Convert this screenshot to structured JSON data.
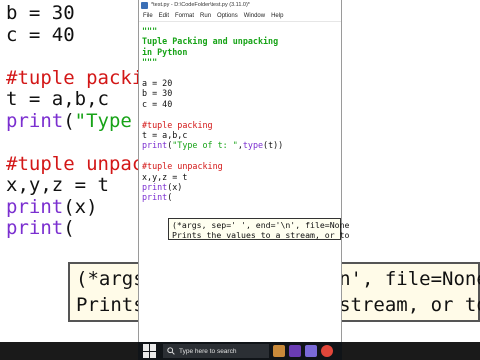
{
  "window": {
    "title": "*test.py - D:\\CodeFolder\\test.py (3.11.0)*",
    "menu": [
      "File",
      "Edit",
      "Format",
      "Run",
      "Options",
      "Window",
      "Help"
    ]
  },
  "editor": {
    "lines": [
      {
        "text": "\"\"\"",
        "kind": "str"
      },
      {
        "text": "Tuple Packing and unpacking",
        "kind": "str"
      },
      {
        "text": "in Python",
        "kind": "str"
      },
      {
        "text": "\"\"\"",
        "kind": "str"
      },
      {
        "text": "",
        "kind": "code"
      },
      {
        "text": "a = 20",
        "kind": "code"
      },
      {
        "text": "b = 30",
        "kind": "code"
      },
      {
        "text": "c = 40",
        "kind": "code"
      },
      {
        "text": "",
        "kind": "code"
      },
      {
        "text": "#tuple packing",
        "kind": "comment"
      },
      {
        "text": "t = a,b,c",
        "kind": "code"
      },
      {
        "text": "print(\"Type of t: \",type(t))",
        "kind": "mixed_print_type"
      },
      {
        "text": "",
        "kind": "code"
      },
      {
        "text": "#tuple unpacking",
        "kind": "comment"
      },
      {
        "text": "x,y,z = t",
        "kind": "code"
      },
      {
        "text": "print(x)",
        "kind": "print"
      },
      {
        "text": "print(",
        "kind": "print"
      }
    ],
    "tooltip": [
      "(*args, sep=' ', end='\\n', file=None",
      "Prints the values to a stream, or to"
    ]
  },
  "background": {
    "lines": [
      {
        "text": "b = 30",
        "kind": "code"
      },
      {
        "text": "c = 40",
        "kind": "code"
      },
      {
        "text": "",
        "kind": "code"
      },
      {
        "text": "#tuple packing",
        "kind": "comment"
      },
      {
        "text": "t = a,b,c",
        "kind": "code"
      },
      {
        "text": "print(\"Type of t: \",type(t))",
        "kind": "print_partial"
      },
      {
        "text": "",
        "kind": "code"
      },
      {
        "text": "#tuple unpacking",
        "kind": "comment"
      },
      {
        "text": "x,y,z = t",
        "kind": "code"
      },
      {
        "text": "print(x)",
        "kind": "print"
      },
      {
        "text": "print(",
        "kind": "print"
      }
    ],
    "tooltip": [
      "(*args, sep=' ', end='\\n', file=None",
      "Prints the values to a stream, or to"
    ]
  },
  "taskbar": {
    "search_placeholder": "Type here to search",
    "app_icons": [
      {
        "name": "edge-flower-icon",
        "color": "#c98a3a"
      },
      {
        "name": "wizard-hat-icon",
        "color": "#6a3cb4"
      },
      {
        "name": "paint-bucket-icon",
        "color": "#7a6ad8"
      },
      {
        "name": "chrome-icon",
        "color": "#e0463a"
      }
    ]
  },
  "colors": {
    "string": "#17a317",
    "comment": "#d31717",
    "builtin": "#7b2fd0",
    "code": "#111111"
  }
}
